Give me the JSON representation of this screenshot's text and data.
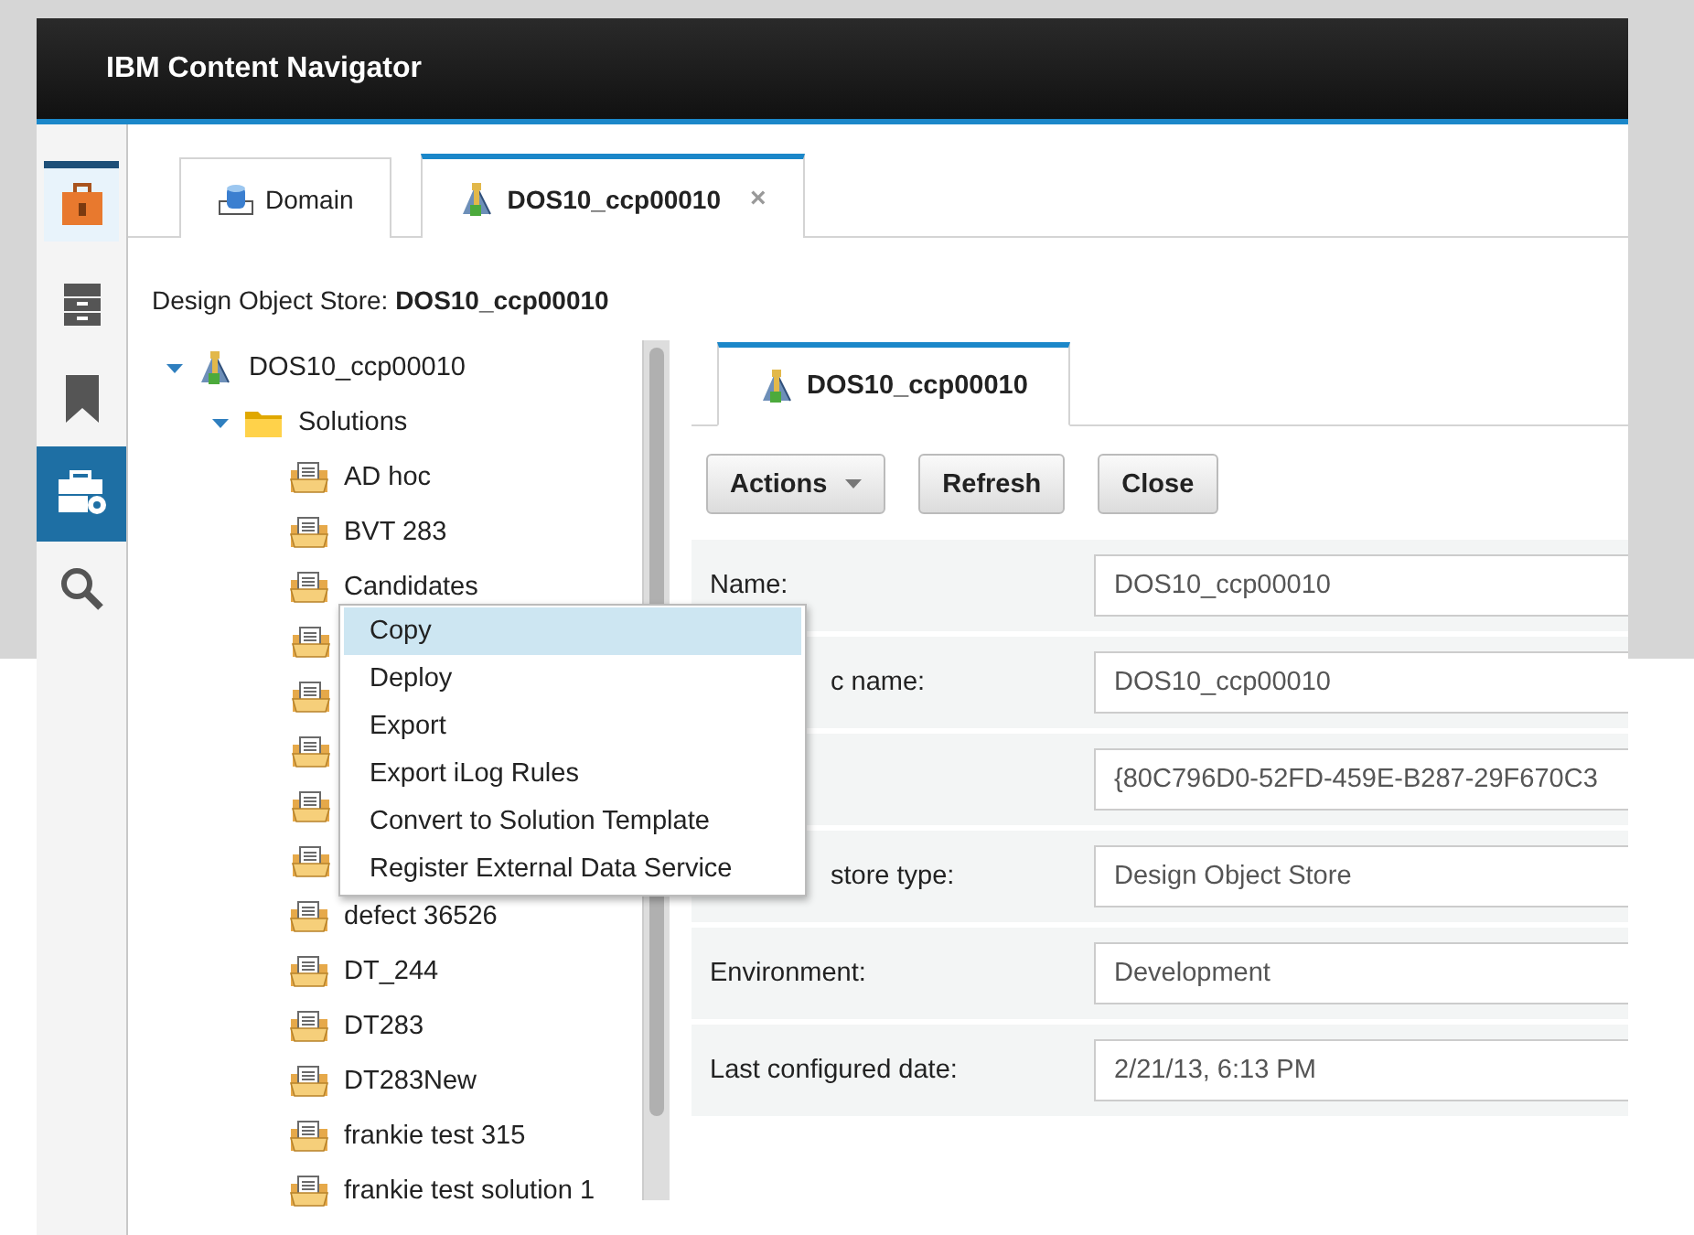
{
  "app": {
    "title": "IBM Content Navigator"
  },
  "rail": [
    {
      "kind": "briefcase",
      "selected": false,
      "highlighted": true
    },
    {
      "kind": "cabinet",
      "selected": false,
      "highlighted": false
    },
    {
      "kind": "bookmark",
      "selected": false,
      "highlighted": false
    },
    {
      "kind": "toolbox",
      "selected": true,
      "highlighted": false
    },
    {
      "kind": "search",
      "selected": false,
      "highlighted": false
    }
  ],
  "tabs": [
    {
      "label": "Domain",
      "kind": "domain",
      "selected": false
    },
    {
      "label": "DOS10_ccp00010",
      "kind": "store",
      "selected": true,
      "close": "×"
    }
  ],
  "store_heading": "Design Object Store: **DOS10_ccp00010**",
  "tree": [
    {
      "label": "DOS10_ccp00010",
      "kind": "store",
      "expanded": true,
      "children": [
        {
          "label": "Solutions",
          "kind": "folder",
          "expanded": true,
          "children": [
            {
              "label": "AD hoc",
              "kind": "solution"
            },
            {
              "label": "BVT 283",
              "kind": "solution"
            },
            {
              "label": "Candidates",
              "kind": "solution"
            },
            {
              "kind": "covered"
            },
            {
              "kind": "covered"
            },
            {
              "kind": "covered"
            },
            {
              "kind": "covered"
            },
            {
              "kind": "covered"
            },
            {
              "label": "defect 36526",
              "kind": "solution"
            },
            {
              "label": "DT_244",
              "kind": "solution"
            },
            {
              "label": "DT283",
              "kind": "solution"
            },
            {
              "label": "DT283New",
              "kind": "solution"
            },
            {
              "label": "frankie test 315",
              "kind": "solution"
            },
            {
              "label": "frankie test solution 1",
              "kind": "solution"
            }
          ]
        }
      ]
    }
  ],
  "context_menu": [
    {
      "label": "Copy",
      "selected": true
    },
    {
      "label": "Deploy",
      "selected": false
    },
    {
      "label": "Export",
      "selected": false
    },
    {
      "label": "Export iLog Rules",
      "selected": false
    },
    {
      "label": "Convert to Solution Template",
      "selected": false
    },
    {
      "label": "Register External Data Service",
      "selected": false
    }
  ],
  "detail_tab": {
    "label": "DOS10_ccp00010",
    "selected": true
  },
  "buttons": [
    {
      "label": "Actions",
      "kind": "dropdown"
    },
    {
      "label": "Refresh",
      "kind": "plain"
    },
    {
      "label": "Close",
      "kind": "plain"
    }
  ],
  "properties": [
    {
      "label": "Name:",
      "kind": "full",
      "value": "DOS10_ccp00010"
    },
    {
      "label": "c name:",
      "kind": "partial",
      "value": "DOS10_ccp00010"
    },
    {
      "kind": "covered",
      "value": "{80C796D0-52FD-459E-B287-29F670C3"
    },
    {
      "label": "store type:",
      "kind": "partial",
      "value": "Design Object Store"
    },
    {
      "label": "Environment:",
      "kind": "full",
      "value": "Development"
    },
    {
      "label": "Last configured date:",
      "kind": "full",
      "value": "2/21/13, 6:13 PM"
    }
  ]
}
